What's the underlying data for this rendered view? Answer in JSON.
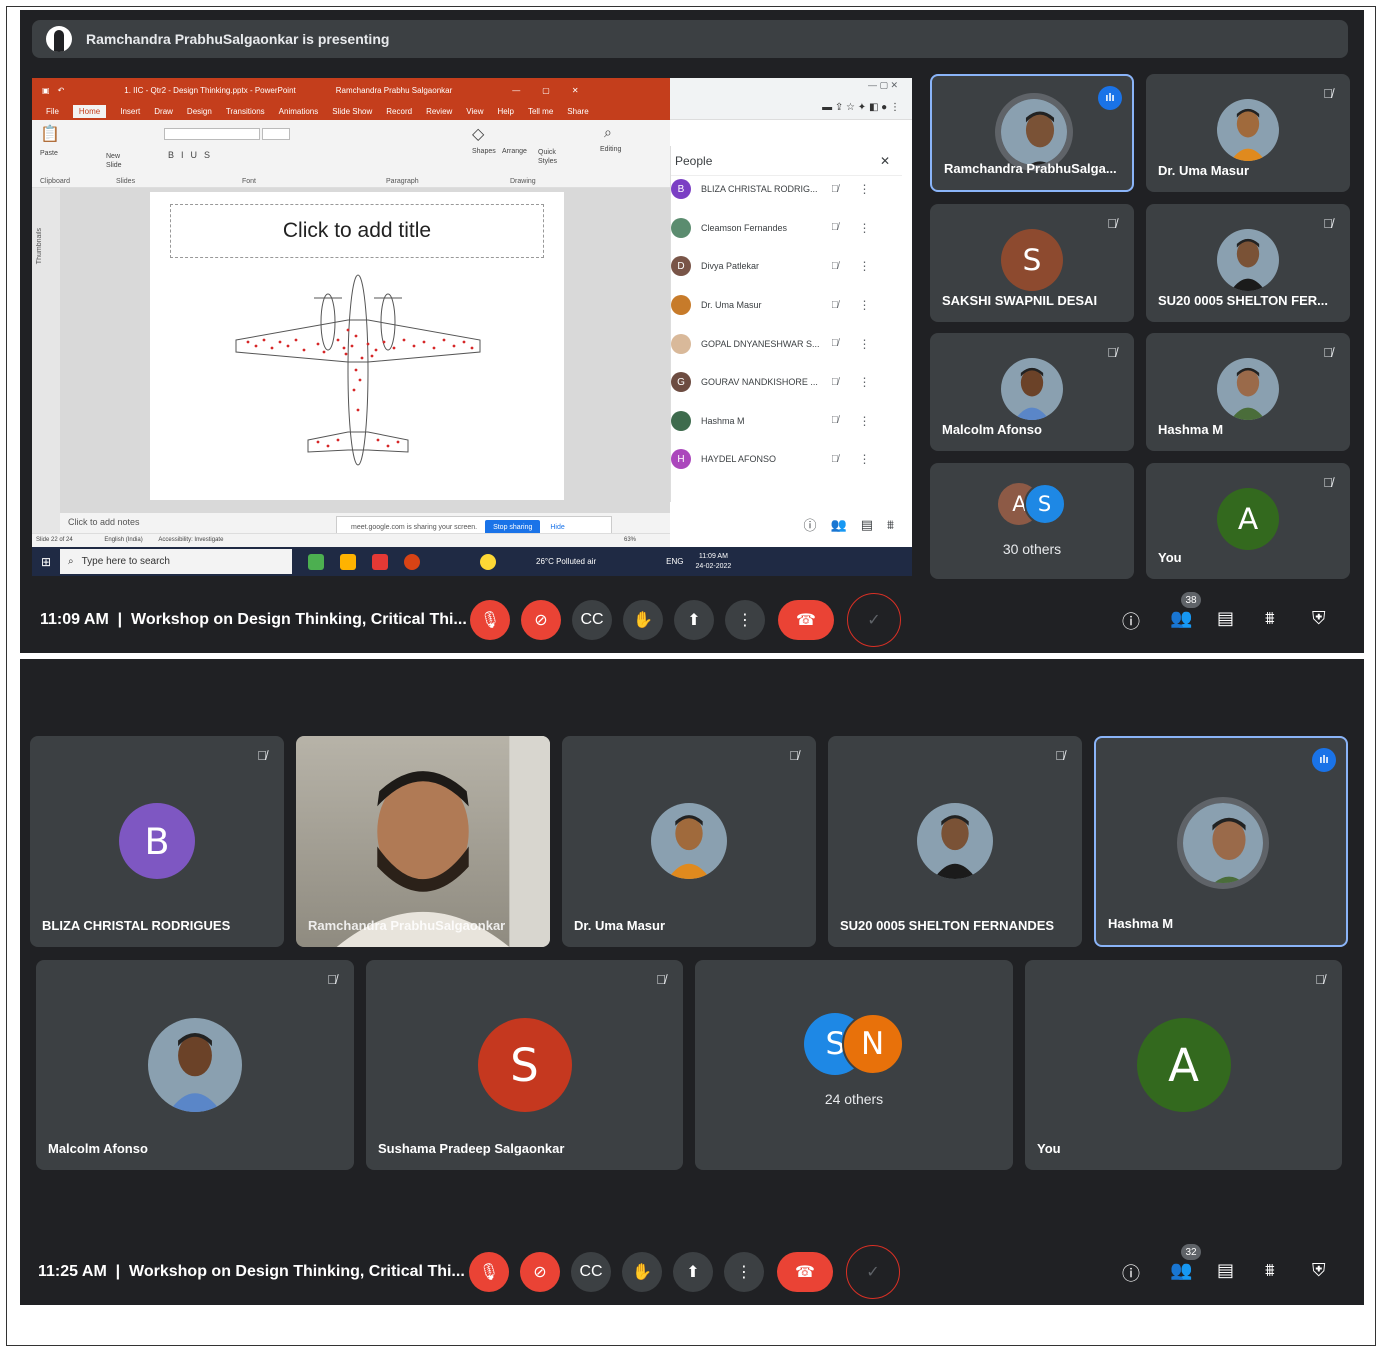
{
  "shot1": {
    "banner": "Ramchandra PrabhuSalgaonkar is presenting",
    "ppt": {
      "file_title": "1. IIC - Qtr2 - Design Thinking.pptx  -  PowerPoint",
      "user": "Ramchandra Prabhu Salgaonkar",
      "menu": [
        "File",
        "Home",
        "Insert",
        "Draw",
        "Design",
        "Transitions",
        "Animations",
        "Slide Show",
        "Record",
        "Review",
        "View",
        "Help",
        "Tell me",
        "Share"
      ],
      "groups": [
        "Clipboard",
        "Slides",
        "Font",
        "Paragraph",
        "Drawing",
        "Editing"
      ],
      "new_slide": "New Slide",
      "paste": "Paste",
      "shapes": "Shapes",
      "arrange": "Arrange",
      "quick_styles": "Quick Styles",
      "thumbnails": "Thumbnails",
      "slide_title": "Click to add title",
      "notes": "Click to add notes",
      "status_slide": "Slide 22 of 24",
      "status_lang": "English (India)",
      "status_access": "Accessibility: Investigate",
      "zoom": "63%",
      "share_msg": "meet.google.com is sharing your screen.",
      "stop_sharing": "Stop sharing",
      "hide": "Hide",
      "taskbar_search": "Type here to search",
      "weather": "26°C  Polluted air",
      "lang": "ENG",
      "clock_time": "11:09 AM",
      "clock_date": "24-02-2022"
    },
    "people_panel": {
      "title": "People",
      "rows": [
        {
          "name": "BLIZA CHRISTAL RODRIG...",
          "initial": "B",
          "color": "#7b3fc4"
        },
        {
          "name": "Cleamson Fernandes",
          "initial": "",
          "color": "#5b8c6f"
        },
        {
          "name": "Divya Patlekar",
          "initial": "D",
          "color": "#795548"
        },
        {
          "name": "Dr. Uma Masur",
          "initial": "",
          "color": "#c77b2a"
        },
        {
          "name": "GOPAL DNYANESHWAR S...",
          "initial": "",
          "color": "#d9b99a"
        },
        {
          "name": "GOURAV NANDKISHORE ...",
          "initial": "G",
          "color": "#6d4c41"
        },
        {
          "name": "Hashma M",
          "initial": "",
          "color": "#3e6b4d"
        },
        {
          "name": "HAYDEL AFONSO",
          "initial": "H",
          "color": "#ab47bc"
        }
      ],
      "badge": "38"
    },
    "tiles": [
      {
        "name": "Ramchandra PrabhuSalga...",
        "active": true
      },
      {
        "name": "Dr. Uma Masur"
      },
      {
        "name": "SAKSHI SWAPNIL DESAI",
        "initial": "S",
        "color": "#8d4a2f"
      },
      {
        "name": "SU20 0005 SHELTON FER..."
      },
      {
        "name": "Malcolm Afonso"
      },
      {
        "name": "Hashma M"
      },
      {
        "others_label": "30 others",
        "i1": "A",
        "c1": "#8d5a46",
        "i2": "S",
        "c2": "#1e88e5"
      },
      {
        "name": "You",
        "initial": "A",
        "color": "#33691e"
      }
    ],
    "time": "11:09 AM",
    "meeting": "Workshop on Design Thinking, Critical Thi...",
    "people_badge": "38"
  },
  "shot2": {
    "tiles_row1": [
      {
        "name": "BLIZA CHRISTAL RODRIGUES",
        "initial": "B",
        "color": "#7e57c2"
      },
      {
        "name": "Ramchandra PrabhuSalgaonkar"
      },
      {
        "name": "Dr. Uma Masur"
      },
      {
        "name": "SU20 0005 SHELTON FERNANDES"
      },
      {
        "name": "Hashma M",
        "active": true
      }
    ],
    "tiles_row2": [
      {
        "name": "Malcolm Afonso"
      },
      {
        "name": "Sushama Pradeep Salgaonkar",
        "initial": "S",
        "color": "#c5381f"
      },
      {
        "others_label": "24 others",
        "i1": "S",
        "c1": "#1e88e5",
        "i2": "N",
        "c2": "#e8710a"
      },
      {
        "name": "You",
        "initial": "A",
        "color": "#33691e"
      }
    ],
    "time": "11:25 AM",
    "meeting": "Workshop on Design Thinking, Critical Thi...",
    "people_badge": "32"
  },
  "colors": {
    "meet_bg": "#202124",
    "tile_bg": "#3c4043",
    "red": "#ea4335",
    "active_border": "#8ab4f8",
    "ppt_red": "#c43e1c"
  },
  "icons": [
    "mic-off-icon",
    "camera-off-icon",
    "captions-icon",
    "raise-hand-icon",
    "present-icon",
    "more-icon",
    "end-call-icon",
    "info-icon",
    "people-icon",
    "chat-icon",
    "activities-icon",
    "host-controls-icon"
  ]
}
